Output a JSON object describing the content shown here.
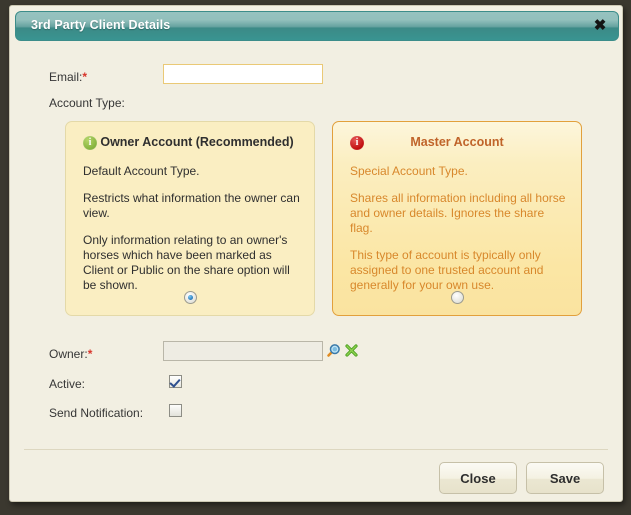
{
  "window": {
    "title": "3rd Party Client Details",
    "close_icon": "close-x-icon"
  },
  "form": {
    "email": {
      "label": "Email:",
      "required_marker": "*",
      "value": "",
      "placeholder": ""
    },
    "account_type_label": "Account Type:",
    "owner": {
      "label": "Owner:",
      "required_marker": "*",
      "value": "",
      "placeholder": "",
      "search_icon": "magnifier-icon",
      "clear_icon": "green-x-icon"
    },
    "active": {
      "label": "Active:",
      "checked": true
    },
    "send_notification": {
      "label": "Send Notification:",
      "checked": false
    }
  },
  "account_options": [
    {
      "icon": "info-icon-green",
      "title": "Owner Account (Recommended)",
      "paragraphs": [
        "Default Account Type.",
        "Restricts what information the owner can view.",
        "Only information relating to an owner's horses which have been marked as Client or Public on the share option will be shown."
      ],
      "selected": true
    },
    {
      "icon": "info-icon-red",
      "title": "Master Account",
      "paragraphs": [
        "Special Account Type.",
        "Shares all information including all horse and owner details. Ignores the share flag.",
        "This type of account is typically only assigned to one trusted account and generally for your own use."
      ],
      "selected": false
    }
  ],
  "footer": {
    "close_label": "Close",
    "save_label": "Save"
  },
  "colors": {
    "titlebar_teal": "#399491",
    "page_background": "#3b382f",
    "dialog_background": "#f2efe2",
    "panel_owner_background": "#faeec2",
    "panel_master_background": "#fbe6a4",
    "panel_master_border": "#e2a03c",
    "master_text": "#d8882c",
    "required_marker": "#d8342a",
    "input_border_gold": "#eac976"
  },
  "icon_glyphs": {
    "info": "i",
    "close": "✖"
  }
}
